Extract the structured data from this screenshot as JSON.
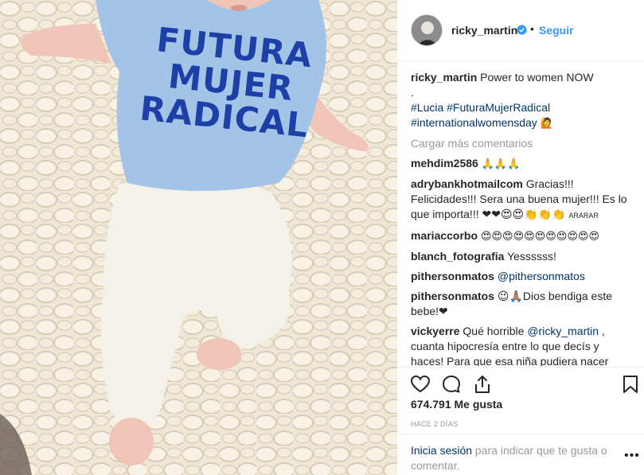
{
  "photo": {
    "shirt_text_lines": [
      "FUTURA",
      "MUJER",
      "RADICAL"
    ],
    "colors": {
      "shirt": "#a3c4e6",
      "shirt_text": "#1d3fa8",
      "blanket": "#efe6d6",
      "pants": "#f3f1ea",
      "skin": "#f0c4b6"
    }
  },
  "header": {
    "username": "ricky_martin",
    "separator": "•",
    "follow_label": "Seguir",
    "verified_icon": "verified-badge-icon"
  },
  "caption": {
    "username": "ricky_martin",
    "text": "Power to women NOW",
    "dot": ".",
    "hashtags_line1": "#Lucia #FuturaMujerRadical",
    "hashtags_line2": "#internationalwomensday",
    "emoji": "🙋"
  },
  "load_more": "Cargar más comentarios",
  "comments": [
    {
      "username": "mehdim2586",
      "text": "🙏🙏🙏"
    },
    {
      "username": "adrybankhotmailcom",
      "text": "Gracias!!! Felicidades!!! Sera una buena mujer!!! Es lo que importa!!! ❤❤😍😍👏👏👏",
      "suffix": "ARARAR"
    },
    {
      "username": "mariaccorbo",
      "text": "😍😍😍😍😍😍😍😍😍😍😍"
    },
    {
      "username": "blanch_fotografia",
      "text": "Yessssss!"
    },
    {
      "username": "pithersonmatos",
      "text": "@pithersonmatos",
      "is_mention": true
    },
    {
      "username": "pithersonmatos",
      "text": "😉🙏🏽Dios bendiga este bebe!❤"
    },
    {
      "username": "vickyerre",
      "text_before": "Qué horrible ",
      "mention": "@ricky_martin",
      "text_after": " , cuanta hipocresía entre lo que decís y haces! Para que esa niña pudiera nacer"
    }
  ],
  "actions": {
    "like_icon": "heart-icon",
    "comment_icon": "comment-icon",
    "share_icon": "share-icon",
    "save_icon": "bookmark-icon"
  },
  "likes": "674.791 Me gusta",
  "timestamp": "HACE 2 DÍAS",
  "login": {
    "link": "Inicia sesión",
    "text": " para indicar que te gusta o comentar.",
    "more": "•••"
  },
  "accent_colors": {
    "link": "#003569",
    "follow": "#3897f0",
    "muted": "#999999"
  }
}
